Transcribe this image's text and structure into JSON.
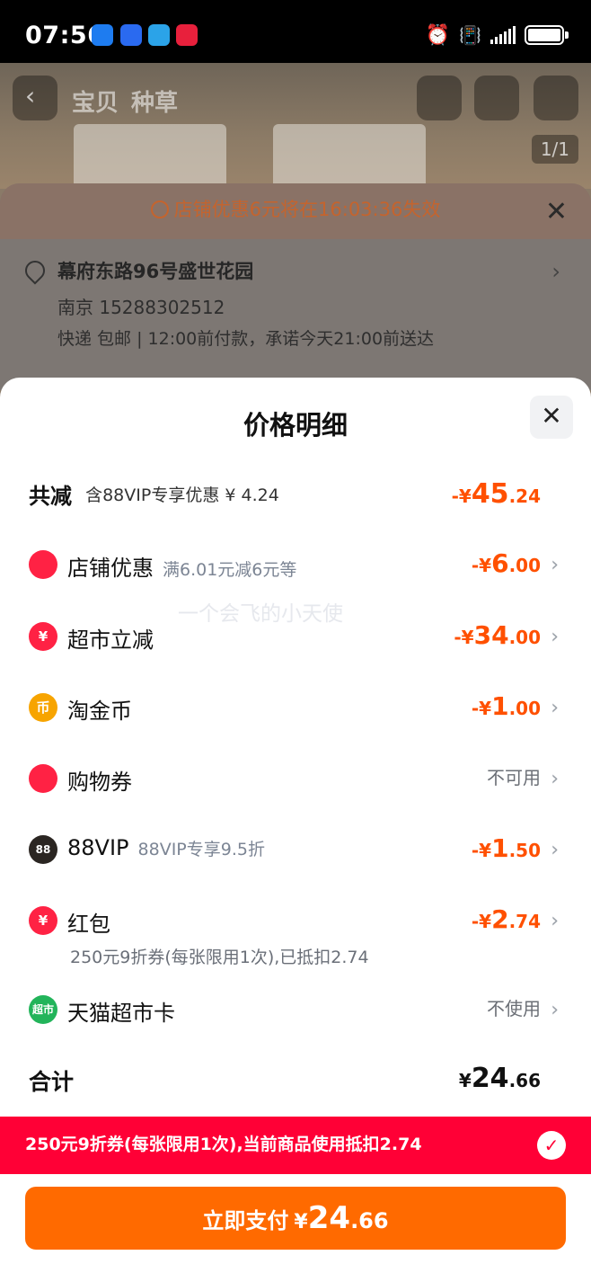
{
  "status_bar": {
    "time": "07:56",
    "app_icons": [
      "app-icon-blue",
      "app-icon-h",
      "app-icon-map",
      "app-icon-tmall"
    ],
    "icons": [
      "alarm-icon",
      "vibrate-icon",
      "signal-icon",
      "battery-icon"
    ]
  },
  "background": {
    "tabs": [
      "宝贝",
      "种草"
    ],
    "image_counter": "1/1",
    "order": {
      "timer_text": "店铺优惠6元将在16:03:36失效",
      "address": "幕府东路96号盛世花园",
      "address_sub": "南京 15288302512",
      "shipping": "快递 包邮 | 12:00前付款，承诺今天21:00前送达"
    }
  },
  "modal": {
    "title": "价格明细",
    "close_label": "✕",
    "total": {
      "label": "共减",
      "sub": "含88VIP专享优惠 ¥ 4.24",
      "sign": "-¥",
      "int": "45",
      "dec": ".24"
    },
    "watermark": "一个会飞的小天使",
    "rows": [
      {
        "icon": "store-icon",
        "icon_text": "",
        "color": "#ff2244",
        "label": "店铺优惠",
        "desc": "满6.01元减6元等",
        "sign": "-¥",
        "int": "6",
        "dec": ".00",
        "muted": "",
        "note": ""
      },
      {
        "icon": "supermarket-discount-icon",
        "icon_text": "¥",
        "color": "#ff2244",
        "label": "超市立减",
        "desc": "",
        "sign": "-¥",
        "int": "34",
        "dec": ".00",
        "muted": "",
        "note": ""
      },
      {
        "icon": "gold-coin-icon",
        "icon_text": "币",
        "color": "#f7a400",
        "label": "淘金币",
        "desc": "",
        "sign": "-¥",
        "int": "1",
        "dec": ".00",
        "muted": "",
        "note": ""
      },
      {
        "icon": "coupon-icon",
        "icon_text": "",
        "color": "#ff2244",
        "label": "购物券",
        "desc": "",
        "sign": "",
        "int": "",
        "dec": "",
        "muted": "不可用",
        "note": ""
      },
      {
        "icon": "88vip-icon",
        "icon_text": "88",
        "color": "#2b2622",
        "label": "88VIP",
        "desc": "88VIP专享9.5折",
        "sign": "-¥",
        "int": "1",
        "dec": ".50",
        "muted": "",
        "note": ""
      },
      {
        "icon": "red-envelope-icon",
        "icon_text": "¥",
        "color": "#ff2244",
        "label": "红包",
        "desc": "",
        "sign": "-¥",
        "int": "2",
        "dec": ".74",
        "muted": "",
        "note": "250元9折券(每张限用1次),已抵扣2.74"
      },
      {
        "icon": "tmall-supermarket-card-icon",
        "icon_text": "超市",
        "color": "#22b45a",
        "label": "天猫超市卡",
        "desc": "",
        "sign": "",
        "int": "",
        "dec": "",
        "muted": "不使用",
        "note": ""
      }
    ],
    "sum": {
      "label": "合计",
      "yen": "¥",
      "int": "24",
      "dec": ".66"
    },
    "coupon_bar": {
      "text": "250元9折券(每张限用1次),当前商品使用抵扣2.74",
      "check": "✓"
    },
    "pay_button": {
      "label": "立即支付",
      "yen": "¥",
      "int": "24",
      "dec": ".66"
    }
  },
  "colors": {
    "accent": "#ff5000",
    "pay_button": "#ff6a00",
    "coupon_bar": "#ff0036"
  }
}
